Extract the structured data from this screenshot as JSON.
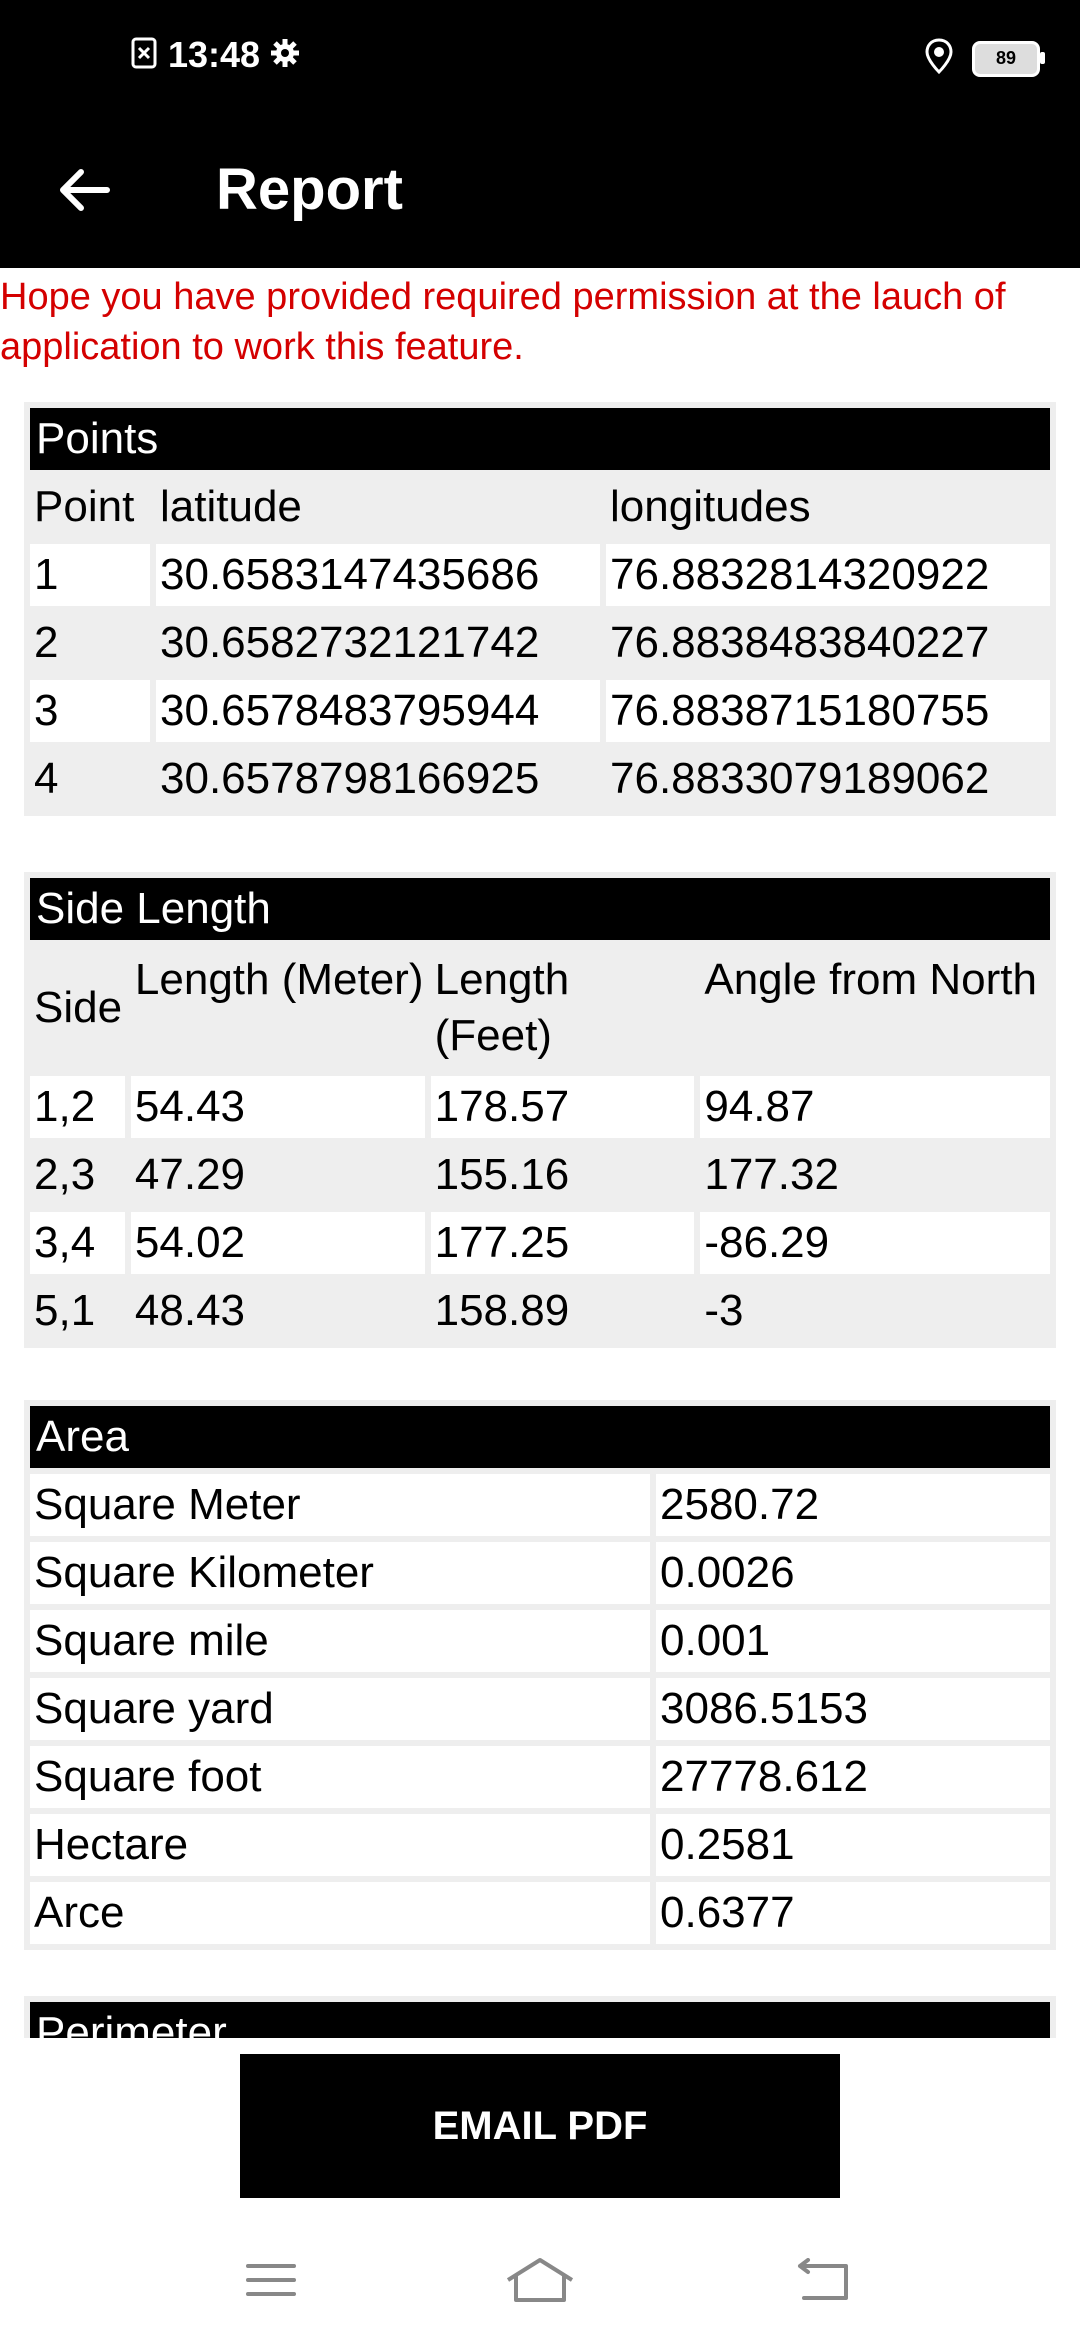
{
  "status_bar": {
    "time": "13:48",
    "battery": "89"
  },
  "app_bar": {
    "title": "Report"
  },
  "warning": "Hope you have provided required permission at the lauch of application to work this feature.",
  "points": {
    "title": "Points",
    "headers": [
      "Point",
      "latitude",
      "longitudes"
    ],
    "rows": [
      [
        "1",
        "30.6583147435686",
        "76.8832814320922"
      ],
      [
        "2",
        "30.6582732121742",
        "76.8838483840227"
      ],
      [
        "3",
        "30.6578483795944",
        "76.8838715180755"
      ],
      [
        "4",
        "30.6578798166925",
        "76.8833079189062"
      ]
    ]
  },
  "side_length": {
    "title": "Side Length",
    "headers": [
      "Side",
      "Length (Meter)",
      "Length (Feet)",
      "Angle from North"
    ],
    "rows": [
      [
        "1,2",
        "54.43",
        "178.57",
        "94.87"
      ],
      [
        "2,3",
        "47.29",
        "155.16",
        "177.32"
      ],
      [
        "3,4",
        "54.02",
        "177.25",
        "-86.29"
      ],
      [
        "5,1",
        "48.43",
        "158.89",
        "-3"
      ]
    ]
  },
  "area": {
    "title": "Area",
    "rows": [
      [
        "Square Meter",
        "2580.72"
      ],
      [
        "Square Kilometer",
        "0.0026"
      ],
      [
        "Square mile",
        "0.001"
      ],
      [
        "Square yard",
        "3086.5153"
      ],
      [
        "Square foot",
        "27778.612"
      ],
      [
        "Hectare",
        "0.2581"
      ],
      [
        "Arce",
        "0.6377"
      ]
    ]
  },
  "perimeter": {
    "title": "Perimeter"
  },
  "email_button": "EMAIL PDF"
}
